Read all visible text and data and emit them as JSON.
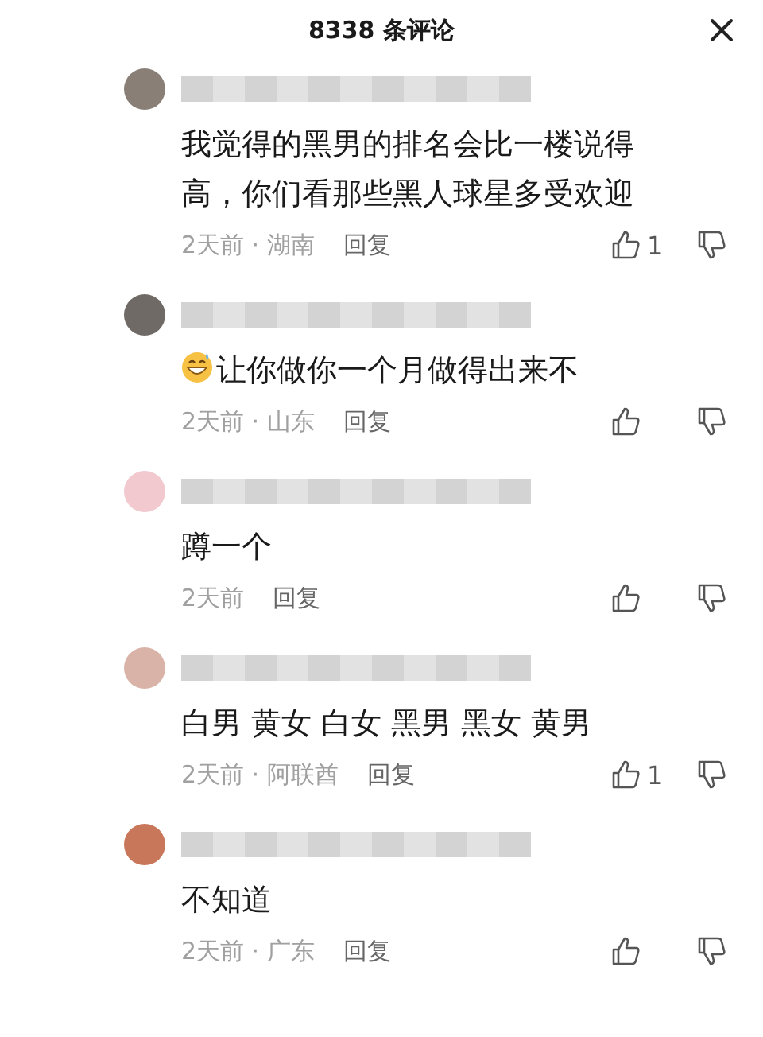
{
  "header": {
    "title": "8338 条评论"
  },
  "comments": [
    {
      "text": "我觉得的黑男的排名会比一楼说得高，你们看那些黑人球星多受欢迎",
      "emoji": false,
      "meta": "2天前 · 湖南",
      "reply": "回复",
      "likes": "1"
    },
    {
      "text": "让你做你一个月做得出来不",
      "emoji": true,
      "meta": "2天前 · 山东",
      "reply": "回复"
    },
    {
      "text": "蹲一个",
      "emoji": false,
      "meta": "2天前",
      "reply": "回复"
    },
    {
      "text": "白男 黄女 白女 黑男 黑女 黄男",
      "emoji": false,
      "meta": "2天前 · 阿联酋",
      "reply": "回复",
      "likes": "1"
    },
    {
      "text": "不知道",
      "emoji": false,
      "meta": "2天前 · 广东",
      "reply": "回复"
    }
  ]
}
